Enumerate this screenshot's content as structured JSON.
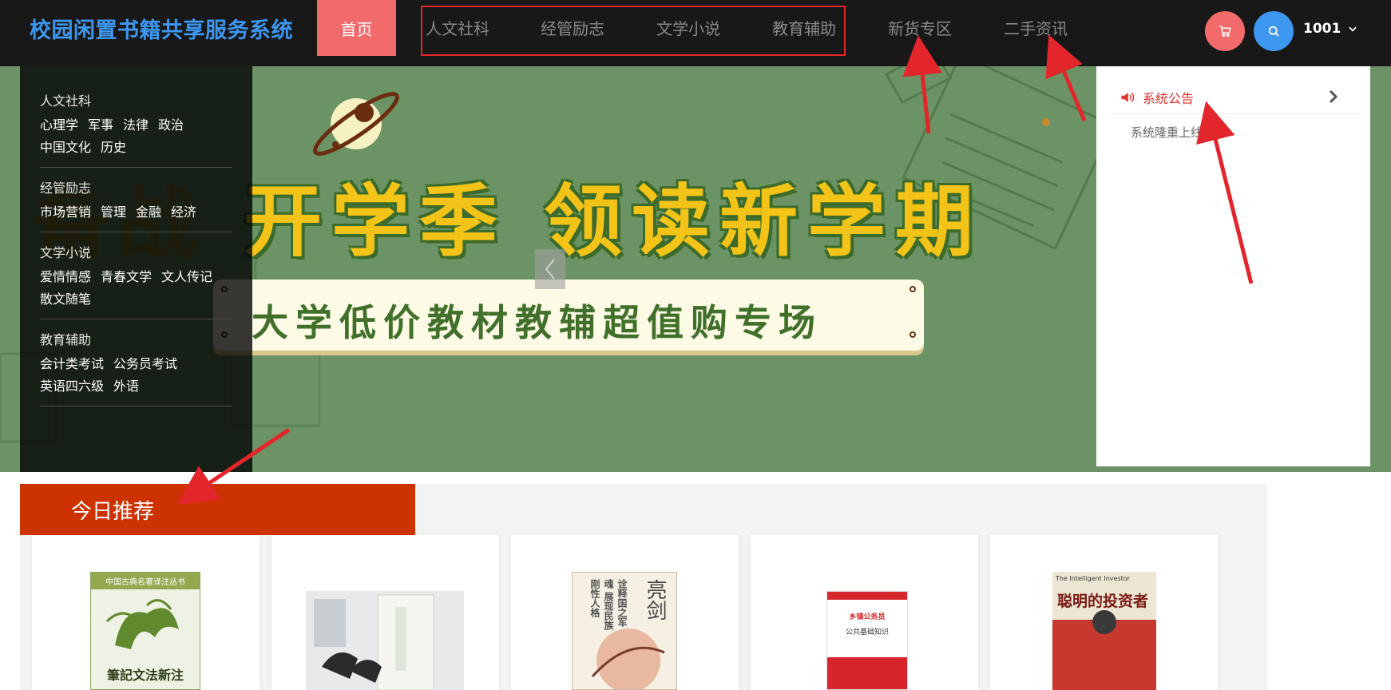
{
  "header": {
    "brand": "校园闲置书籍共享服务系统",
    "nav": {
      "home": "首页",
      "categories": [
        "人文社科",
        "经管励志",
        "文学小说",
        "教育辅助"
      ],
      "new_goods": "新货专区",
      "secondhand_news": "二手资讯"
    },
    "user": "1001",
    "icons": {
      "cart": "cart-icon",
      "search": "search-icon",
      "dropdown": "chevron-down-icon"
    }
  },
  "banner": {
    "headline": "开学季  领读新学期",
    "headline_partial": "备战",
    "subline": "大学低价教材教辅超值购专场"
  },
  "sidebar": {
    "groups": [
      {
        "title": "人文社科",
        "items": [
          "心理学",
          "军事",
          "法律",
          "政治",
          "中国文化",
          "历史"
        ]
      },
      {
        "title": "经管励志",
        "items": [
          "市场营销",
          "管理",
          "金融",
          "经济"
        ]
      },
      {
        "title": "文学小说",
        "items": [
          "爱情情感",
          "青春文学",
          "文人传记",
          "散文随笔"
        ]
      },
      {
        "title": "教育辅助",
        "items": [
          "会计类考试",
          "公务员考试",
          "英语四六级",
          "外语"
        ]
      }
    ]
  },
  "notice": {
    "title": "系统公告",
    "items": [
      "系统隆重上线"
    ]
  },
  "recommend": {
    "title": "今日推荐",
    "books": [
      {
        "cover_title": "中国古典名著译注丛书",
        "cover_text": "筆記文法新注"
      },
      {
        "cover_title": "",
        "cover_text": ""
      },
      {
        "cover_title": "亮剑",
        "cover_text": "诠释国之军魂 展现民族刚性人格"
      },
      {
        "cover_title": "乡镇公务员",
        "cover_text": "公共基础知识"
      },
      {
        "cover_title": "聪明的投资者",
        "cover_text": "The Intelligent Investor"
      }
    ]
  },
  "colors": {
    "topbar": "#181818",
    "brand": "#3d96f0",
    "home_bg": "#f26b6b",
    "banner_bg": "#6b9365",
    "headline": "#f3c318",
    "recommend_header": "#cc3300",
    "annotation": "#e2262b"
  }
}
